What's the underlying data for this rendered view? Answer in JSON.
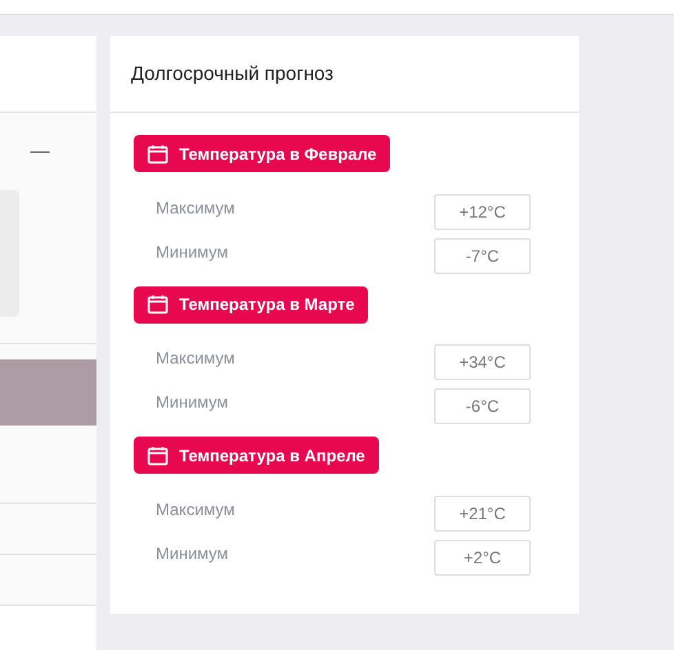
{
  "left_panel": {
    "collapse_mark": "—"
  },
  "forecast": {
    "title": "Долгосрочный прогноз",
    "months": [
      {
        "title": "Температура в Феврале",
        "rows": [
          {
            "label": "Максимум",
            "value": "+12°C"
          },
          {
            "label": "Минимум",
            "value": "-7°C"
          }
        ]
      },
      {
        "title": "Температура в Марте",
        "rows": [
          {
            "label": "Максимум",
            "value": "+34°C"
          },
          {
            "label": "Минимум",
            "value": "-6°C"
          }
        ]
      },
      {
        "title": "Температура в Апреле",
        "rows": [
          {
            "label": "Максимум",
            "value": "+21°C"
          },
          {
            "label": "Минимум",
            "value": "+2°C"
          }
        ]
      }
    ]
  }
}
